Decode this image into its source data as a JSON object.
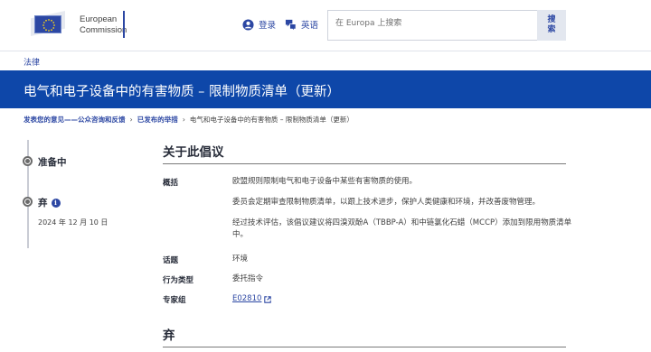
{
  "header": {
    "logo_line1": "European",
    "logo_line2": "Commission",
    "login_label": "登录",
    "language_label": "英语",
    "search_placeholder": "在 Europa 上搜索",
    "search_button_label": "搜索"
  },
  "nav": {
    "law_label": "法律"
  },
  "banner": {
    "title": "电气和电子设备中的有害物质 – 限制物质清单（更新）"
  },
  "breadcrumb": {
    "items": [
      "发表您的意见——公众咨询和反馈",
      "已发布的举措",
      "电气和电子设备中的有害物质 – 限制物质清单（更新）"
    ]
  },
  "timeline": {
    "stage1_label": "准备中",
    "stage2_label": "弃",
    "stage2_date": "2024 年 12 月 10 日"
  },
  "initiative": {
    "heading": "关于此倡议",
    "summary_label": "概括",
    "summary_p1": "欧盟规则限制电气和电子设备中某些有害物质的使用。",
    "summary_p2": "委员会定期审查限制物质清单，以跟上技术进步，保护人类健康和环境，并改善废物管理。",
    "summary_p3": "经过技术评估，该倡议建议将四溴双酚A（TBBP-A）和中链氯化石蜡（MCCP）添加到限用物质清单中。",
    "topic_label": "话题",
    "topic_value": "环境",
    "type_label": "行为类型",
    "type_value": "委托指令",
    "group_label": "专家组",
    "group_value": "E02810"
  },
  "section2": {
    "heading": "弃"
  },
  "colors": {
    "brand_blue": "#0e47a9",
    "link_blue": "#2c47a3"
  }
}
